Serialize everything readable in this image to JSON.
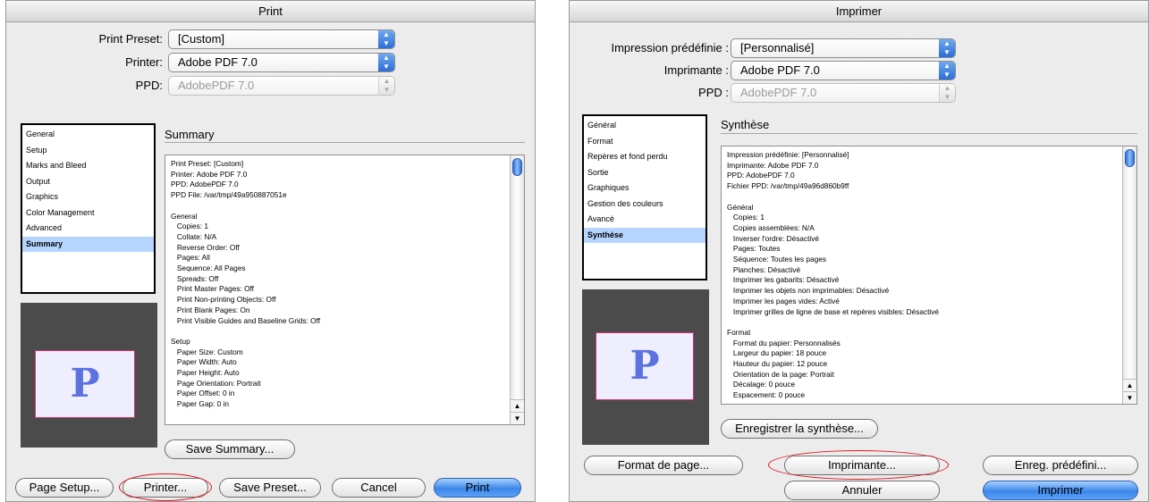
{
  "left": {
    "title": "Print",
    "preset_label": "Print Preset:",
    "preset_value": "[Custom]",
    "printer_label": "Printer:",
    "printer_value": "Adobe PDF 7.0",
    "ppd_label": "PPD:",
    "ppd_value": "AdobePDF 7.0",
    "categories": [
      "General",
      "Setup",
      "Marks and Bleed",
      "Output",
      "Graphics",
      "Color Management",
      "Advanced",
      "Summary"
    ],
    "selected_category": "Summary",
    "preview_letter": "P",
    "section_title": "Summary",
    "summary_text": "Print Preset: [Custom]\nPrinter: Adobe PDF 7.0\nPPD: AdobePDF 7.0\nPPD File: /var/tmp/49a950887051e\n\nGeneral\n   Copies: 1\n   Collate: N/A\n   Reverse Order: Off\n   Pages: All\n   Sequence: All Pages\n   Spreads: Off\n   Print Master Pages: Off\n   Print Non-printing Objects: Off\n   Print Blank Pages: On\n   Print Visible Guides and Baseline Grids: Off\n\nSetup\n   Paper Size: Custom\n   Paper Width: Auto\n   Paper Height: Auto\n   Page Orientation: Portrait\n   Paper Offset: 0 in\n   Paper Gap: 0 in",
    "save_summary": "Save Summary...",
    "page_setup": "Page Setup...",
    "printer_button": "Printer...",
    "save_preset": "Save Preset...",
    "cancel": "Cancel",
    "print": "Print"
  },
  "right": {
    "title": "Imprimer",
    "preset_label": "Impression prédéfinie :",
    "preset_value": "[Personnalisé]",
    "printer_label": "Imprimante :",
    "printer_value": "Adobe PDF 7.0",
    "ppd_label": "PPD :",
    "ppd_value": "AdobePDF 7.0",
    "categories": [
      "Général",
      "Format",
      "Repères et fond perdu",
      "Sortie",
      "Graphiques",
      "Gestion des couleurs",
      "Avancé",
      "Synthèse"
    ],
    "selected_category": "Synthèse",
    "preview_letter": "P",
    "section_title": "Synthèse",
    "summary_text": "Impression prédéfinie: [Personnalisé]\nImprimante: Adobe PDF 7.0\nPPD: AdobePDF 7.0\nFichier PPD: /var/tmp/49a96d860b9ff\n\nGénéral\n   Copies: 1\n   Copies assemblées: N/A\n   Inverser l'ordre: Désactivé\n   Pages: Toutes\n   Séquence: Toutes les pages\n   Planches: Désactivé\n   Imprimer les gabarits: Désactivé\n   Imprimer les objets non imprimables: Désactivé\n   Imprimer les pages vides: Activé\n   Imprimer grilles de ligne de base et repères visibles: Désactivé\n\nFormat\n   Format du papier: Personnalisés\n   Largeur du papier: 18 pouce\n   Hauteur du papier: 12 pouce\n   Orientation de la page: Portrait\n   Décalage: 0 pouce\n   Espacement: 0 pouce",
    "save_summary": "Enregistrer la synthèse...",
    "page_setup": "Format de page...",
    "printer_button": "Imprimante...",
    "save_preset": "Enreg. prédéfini...",
    "cancel": "Annuler",
    "print": "Imprimer"
  },
  "colors": {
    "annotation": "#e0141e",
    "selection": "#b5d5ff",
    "default_button": "#3c87ea"
  }
}
